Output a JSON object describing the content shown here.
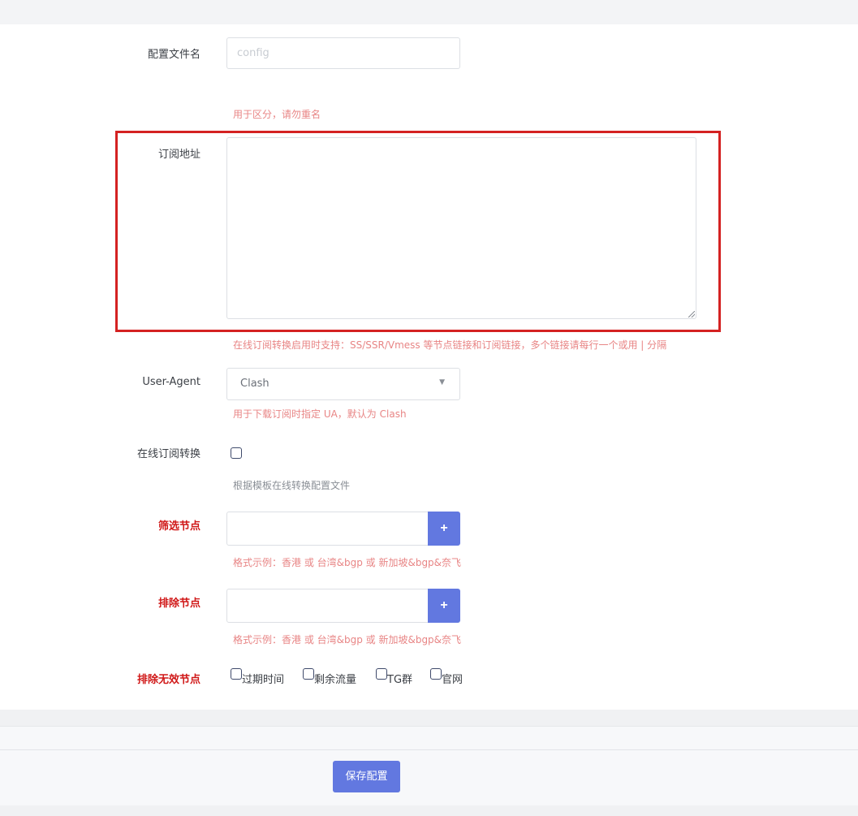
{
  "form": {
    "config_name": {
      "label": "配置文件名",
      "placeholder": "config",
      "help": "用于区分，请勿重名"
    },
    "subscription_url": {
      "label": "订阅地址",
      "value": "",
      "help": "在线订阅转换启用时支持：SS/SSR/Vmess 等节点链接和订阅链接，多个链接请每行一个或用 | 分隔"
    },
    "user_agent": {
      "label": "User-Agent",
      "selected": "Clash",
      "arrow_icon": "caret-down-icon",
      "help": "用于下载订阅时指定 UA，默认为 Clash"
    },
    "online_convert": {
      "label": "在线订阅转换",
      "checked": false,
      "help": "根据模板在线转换配置文件"
    },
    "filter_nodes": {
      "label": "筛选节点",
      "button": "+",
      "help": "格式示例：香港 或 台湾&bgp 或 新加坡&bgp&奈飞"
    },
    "exclude_nodes": {
      "label": "排除节点",
      "button": "+",
      "help": "格式示例：香港 或 台湾&bgp 或 新加坡&bgp&奈飞"
    },
    "exclude_invalid": {
      "label": "排除无效节点",
      "options": [
        "过期时间",
        "剩余流量",
        "TG群",
        "官网"
      ]
    }
  },
  "footer": {
    "save_label": "保存配置"
  },
  "colors": {
    "accent": "#6278e0",
    "highlight_box": "#d42222",
    "required_label": "#d01818",
    "help_text": "#e88585"
  }
}
